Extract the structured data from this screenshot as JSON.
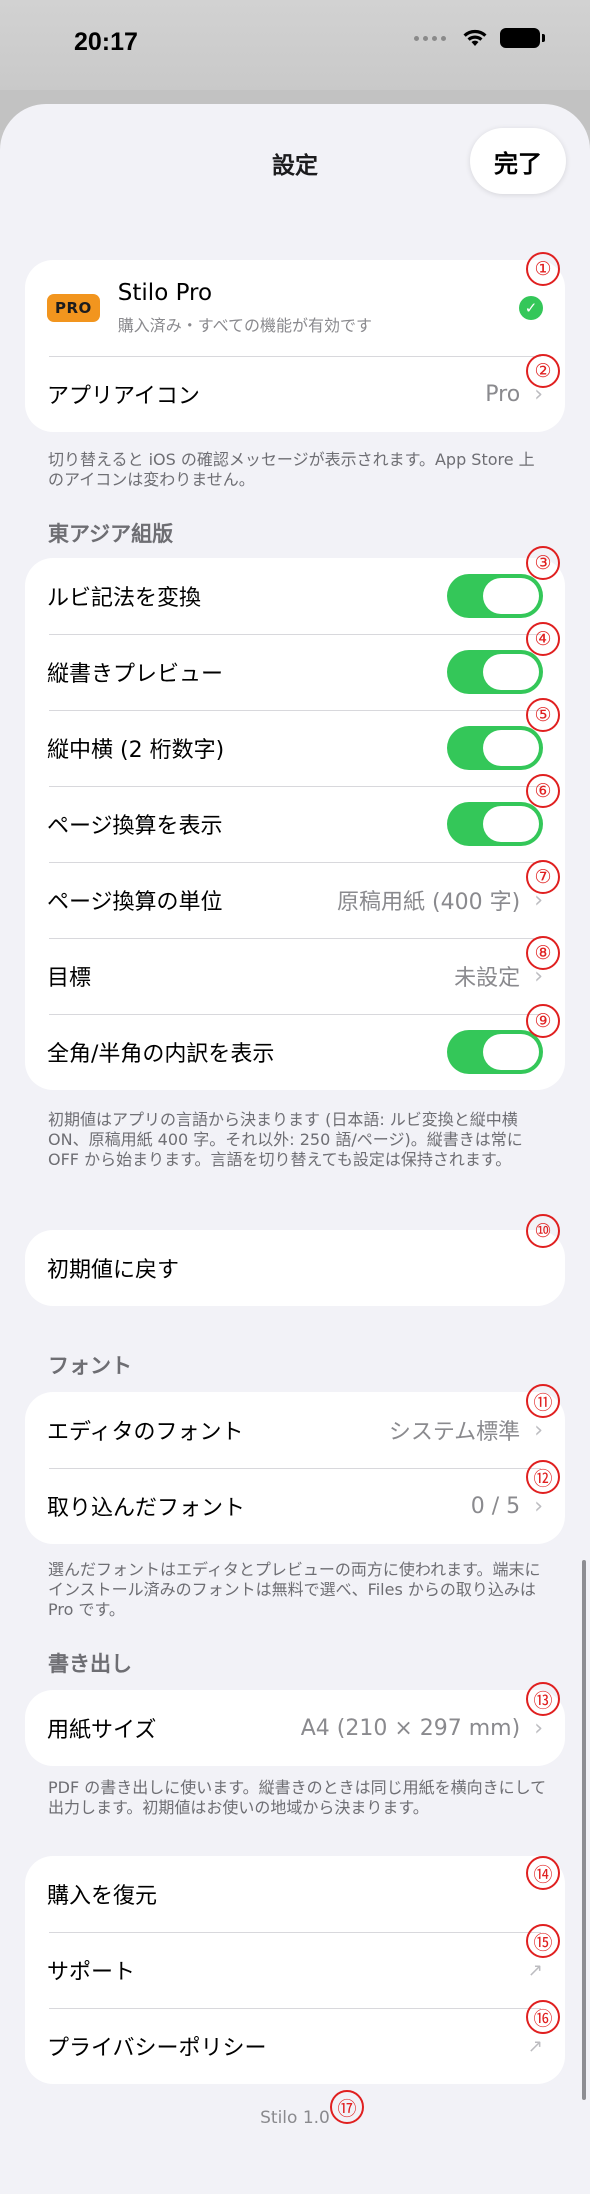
{
  "status_bar": {
    "time": "20:17"
  },
  "nav": {
    "title": "設定",
    "done_label": "完了"
  },
  "pro": {
    "badge": "PRO",
    "title": "Stilo Pro",
    "subtitle": "購入済み・すべての機能が有効です"
  },
  "app_icon": {
    "label": "アプリアイコン",
    "value": "Pro"
  },
  "app_icon_note": "切り替えると iOS の確認メッセージが表示されます。App Store 上のアイコンは変わりません。",
  "east_asian": {
    "header": "東アジア組版",
    "ruby": "ルビ記法を変換",
    "vertical_preview": "縦書きプレビュー",
    "tcy": "縦中横 (2 桁数字)",
    "page_count": "ページ換算を表示",
    "page_unit_label": "ページ換算の単位",
    "page_unit_value": "原稿用紙 (400 字)",
    "goal_label": "目標",
    "goal_value": "未設定",
    "width_breakdown": "全角/半角の内訳を表示",
    "note": "初期値はアプリの言語から決まります (日本語: ルビ変換と縦中横 ON、原稿用紙 400 字。それ以外: 250 語/ページ)。縦書きは常に OFF から始まります。言語を切り替えても設定は保持されます。"
  },
  "toggles": {
    "ruby": true,
    "vertical_preview": true,
    "tcy": true,
    "page_count": true,
    "width_breakdown": true
  },
  "reset_label": "初期値に戻す",
  "font": {
    "header": "フォント",
    "editor_label": "エディタのフォント",
    "editor_value": "システム標準",
    "imported_label": "取り込んだフォント",
    "imported_value": "0 / 5",
    "note": "選んだフォントはエディタとプレビューの両方に使われます。端末にインストール済みのフォントは無料で選べ、Files からの取り込みは Pro です。"
  },
  "export": {
    "header": "書き出し",
    "paper_label": "用紙サイズ",
    "paper_value": "A4 (210 × 297 mm)",
    "note": "PDF の書き出しに使います。縦書きのときは同じ用紙を横向きにして出力します。初期値はお使いの地域から決まります。"
  },
  "misc": {
    "restore": "購入を復元",
    "support": "サポート",
    "privacy": "プライバシーポリシー"
  },
  "version": "Stilo 1.0",
  "annotations": [
    "①",
    "②",
    "③",
    "④",
    "⑤",
    "⑥",
    "⑦",
    "⑧",
    "⑨",
    "⑩",
    "⑪",
    "⑫",
    "⑬",
    "⑭",
    "⑮",
    "⑯",
    "⑰"
  ],
  "colors": {
    "toggle_on": "#34c759",
    "pro_badge": "#f2951e",
    "annotation": "#e02020"
  }
}
